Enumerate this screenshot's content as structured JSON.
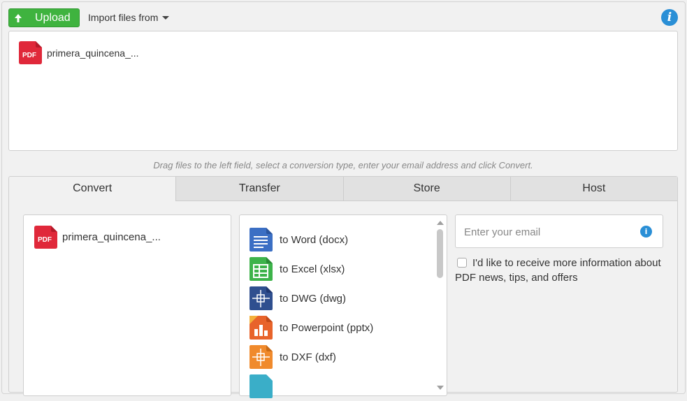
{
  "toolbar": {
    "upload_label": "Upload",
    "import_label": "Import files from",
    "info_icon": "info-icon"
  },
  "dropzone": {
    "files": [
      {
        "name": "primera_quincena_...",
        "icon": "pdf-file-icon",
        "badge": "PDF"
      }
    ]
  },
  "hint": "Drag files to the left field, select a conversion type, enter your email address and click Convert.",
  "tabs": [
    {
      "label": "Convert",
      "active": true
    },
    {
      "label": "Transfer",
      "active": false
    },
    {
      "label": "Store",
      "active": false
    },
    {
      "label": "Host",
      "active": false
    }
  ],
  "convert": {
    "files": [
      {
        "name": "primera_quincena_...",
        "badge": "PDF"
      }
    ],
    "conversions": [
      {
        "label": "to Word (docx)",
        "icon": "word-doc-icon",
        "color": "#3b6fc4"
      },
      {
        "label": "to Excel (xlsx)",
        "icon": "excel-sheet-icon",
        "color": "#3db34a"
      },
      {
        "label": "to DWG (dwg)",
        "icon": "dwg-drawing-icon",
        "color": "#2f4f8f"
      },
      {
        "label": "to Powerpoint (pptx)",
        "icon": "powerpoint-icon",
        "color": "#e8632a"
      },
      {
        "label": "to DXF (dxf)",
        "icon": "dxf-drawing-icon",
        "color": "#f08a2c"
      }
    ],
    "email": {
      "placeholder": "Enter your email",
      "value": ""
    },
    "optin_label": "I'd like to receive more information about PDF news, tips, and offers"
  },
  "colors": {
    "upload": "#3fb33f",
    "info": "#2a8fd6",
    "pdf": "#e0283a"
  }
}
